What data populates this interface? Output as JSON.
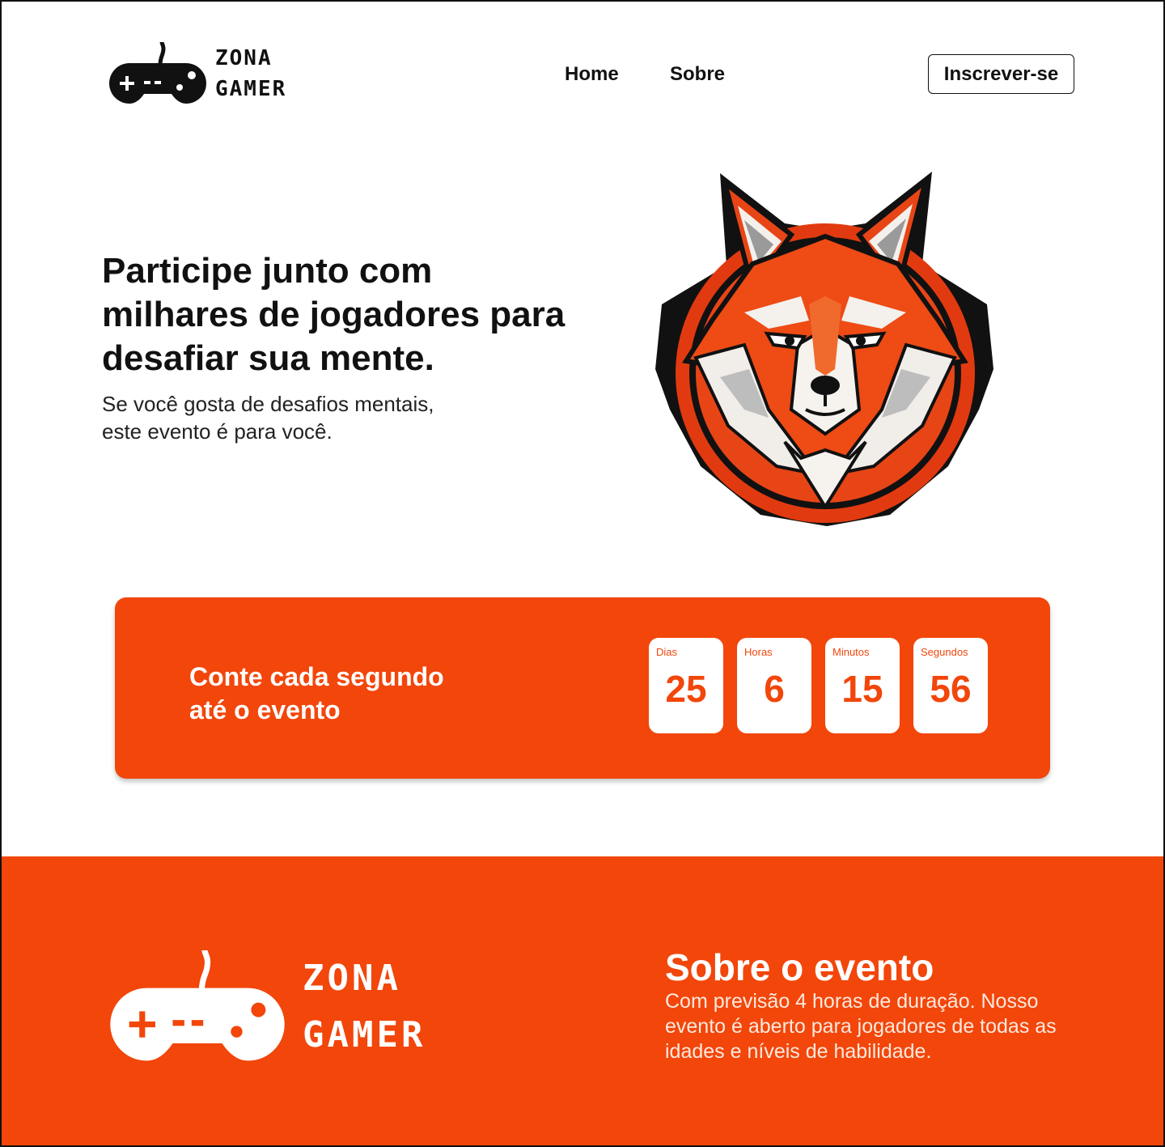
{
  "brand": {
    "line1": "ZONA",
    "line2": "GAMER",
    "logo_icon": "gamepad-icon"
  },
  "nav": {
    "items": [
      {
        "label": "Home"
      },
      {
        "label": "Sobre"
      }
    ],
    "cta_label": "Inscrever-se"
  },
  "hero": {
    "title": "Participe junto com milhares de jogadores para desafiar sua mente.",
    "subtitle": "Se você gosta de desafios mentais, este evento é para você.",
    "image": "fox-mascot"
  },
  "countdown": {
    "heading_line1": "Conte cada segundo",
    "heading_line2": "até o evento",
    "units": [
      {
        "label": "Dias",
        "value": "25"
      },
      {
        "label": "Horas",
        "value": "6"
      },
      {
        "label": "Minutos",
        "value": "15"
      },
      {
        "label": "Segundos",
        "value": "56"
      }
    ]
  },
  "about": {
    "title": "Sobre o evento",
    "description": "Com previsão 4 horas de duração. Nosso evento é aberto para jogadores de todas as idades e níveis de habilidade."
  },
  "colors": {
    "accent": "#f2460b",
    "text": "#111111",
    "background": "#ffffff"
  }
}
